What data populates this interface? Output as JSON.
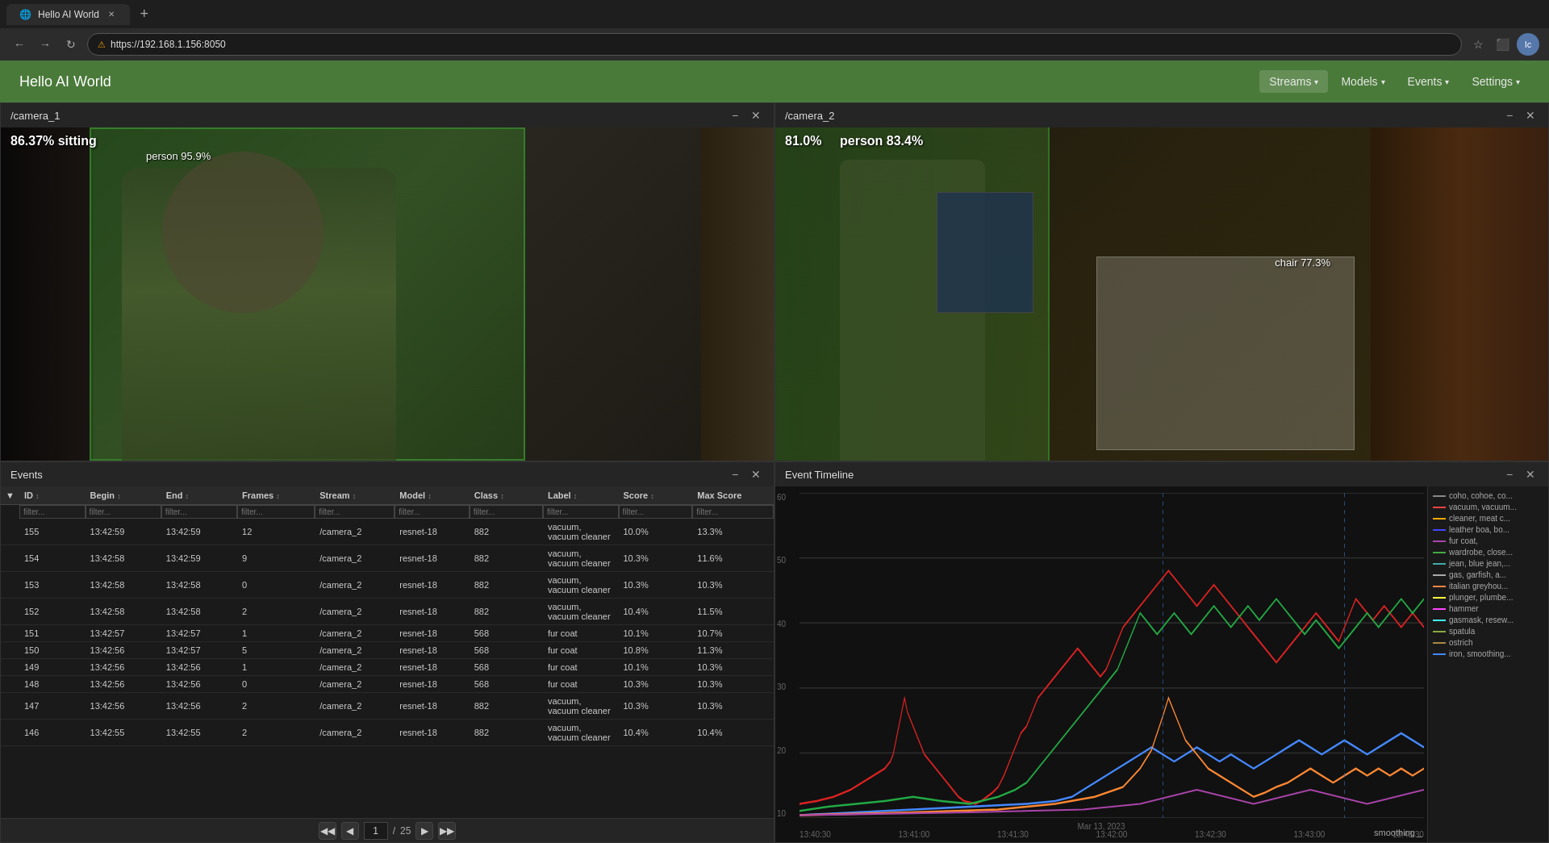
{
  "browser": {
    "tab_title": "Hello AI World",
    "address": "https://192.168.1.156:8050",
    "lock_icon": "⚠",
    "new_tab_icon": "+"
  },
  "app": {
    "title": "Hello AI World",
    "nav": [
      {
        "label": "Streams",
        "has_dropdown": true
      },
      {
        "label": "Models",
        "has_dropdown": true
      },
      {
        "label": "Events",
        "has_dropdown": true
      },
      {
        "label": "Settings",
        "has_dropdown": true
      }
    ]
  },
  "camera1": {
    "title": "/camera_1",
    "label_text": "86.37% sitting",
    "detection1_label": "person 95.9%"
  },
  "camera2": {
    "title": "/camera_2",
    "label_text1": "81.0%",
    "label_text2": "person 83.4%",
    "detection_chair": "chair 77.3%"
  },
  "events": {
    "panel_title": "Events",
    "columns": [
      {
        "label": "ID",
        "sort": "↕"
      },
      {
        "label": "Begin",
        "sort": "↕"
      },
      {
        "label": "End",
        "sort": "↕"
      },
      {
        "label": "Frames",
        "sort": "↕"
      },
      {
        "label": "Stream",
        "sort": "↕"
      },
      {
        "label": "Model",
        "sort": "↕"
      },
      {
        "label": "Class",
        "sort": "↕"
      },
      {
        "label": "Label",
        "sort": "↕"
      },
      {
        "label": "Score",
        "sort": "↕"
      },
      {
        "label": "Max Score",
        "sort": ""
      }
    ],
    "filters": [
      "filter...",
      "filter...",
      "filter...",
      "filter...",
      "filter...",
      "filter...",
      "filter...",
      "filter...",
      "filter...",
      "filter..."
    ],
    "rows": [
      {
        "id": "155",
        "begin": "13:42:59",
        "end": "13:42:59",
        "frames": "12",
        "stream": "/camera_2",
        "model": "resnet-18",
        "class": "882",
        "label": "vacuum, vacuum cleaner",
        "score": "10.0%",
        "max_score": "13.3%"
      },
      {
        "id": "154",
        "begin": "13:42:58",
        "end": "13:42:59",
        "frames": "9",
        "stream": "/camera_2",
        "model": "resnet-18",
        "class": "882",
        "label": "vacuum, vacuum cleaner",
        "score": "10.3%",
        "max_score": "11.6%"
      },
      {
        "id": "153",
        "begin": "13:42:58",
        "end": "13:42:58",
        "frames": "0",
        "stream": "/camera_2",
        "model": "resnet-18",
        "class": "882",
        "label": "vacuum, vacuum cleaner",
        "score": "10.3%",
        "max_score": "10.3%"
      },
      {
        "id": "152",
        "begin": "13:42:58",
        "end": "13:42:58",
        "frames": "2",
        "stream": "/camera_2",
        "model": "resnet-18",
        "class": "882",
        "label": "vacuum, vacuum cleaner",
        "score": "10.4%",
        "max_score": "11.5%"
      },
      {
        "id": "151",
        "begin": "13:42:57",
        "end": "13:42:57",
        "frames": "1",
        "stream": "/camera_2",
        "model": "resnet-18",
        "class": "568",
        "label": "fur coat",
        "score": "10.1%",
        "max_score": "10.7%"
      },
      {
        "id": "150",
        "begin": "13:42:56",
        "end": "13:42:57",
        "frames": "5",
        "stream": "/camera_2",
        "model": "resnet-18",
        "class": "568",
        "label": "fur coat",
        "score": "10.8%",
        "max_score": "11.3%"
      },
      {
        "id": "149",
        "begin": "13:42:56",
        "end": "13:42:56",
        "frames": "1",
        "stream": "/camera_2",
        "model": "resnet-18",
        "class": "568",
        "label": "fur coat",
        "score": "10.1%",
        "max_score": "10.3%"
      },
      {
        "id": "148",
        "begin": "13:42:56",
        "end": "13:42:56",
        "frames": "0",
        "stream": "/camera_2",
        "model": "resnet-18",
        "class": "568",
        "label": "fur coat",
        "score": "10.3%",
        "max_score": "10.3%"
      },
      {
        "id": "147",
        "begin": "13:42:56",
        "end": "13:42:56",
        "frames": "2",
        "stream": "/camera_2",
        "model": "resnet-18",
        "class": "882",
        "label": "vacuum, vacuum cleaner",
        "score": "10.3%",
        "max_score": "10.3%"
      },
      {
        "id": "146",
        "begin": "13:42:55",
        "end": "13:42:55",
        "frames": "2",
        "stream": "/camera_2",
        "model": "resnet-18",
        "class": "882",
        "label": "vacuum, vacuum cleaner",
        "score": "10.4%",
        "max_score": "10.4%"
      }
    ],
    "pagination": {
      "current_page": "1",
      "total_pages": "25",
      "prev_icon": "◀",
      "next_icon": "▶",
      "first_icon": "◀◀",
      "last_icon": "▶▶"
    }
  },
  "timeline": {
    "panel_title": "Event Timeline",
    "y_axis": [
      "60",
      "50",
      "40",
      "30",
      "20",
      "10"
    ],
    "x_axis": [
      "13:43:30",
      "13:41:00",
      "13:41:30",
      "13:42:00",
      "13:42:30",
      "13:43:00",
      "13:43:30"
    ],
    "date_label": "Mar 13, 2023",
    "smoothing_label": "smoothing _",
    "legend": [
      {
        "label": "coho, cohoe, co...",
        "color": "#888888"
      },
      {
        "label": "vacuum, vacuum...",
        "color": "#ff4444"
      },
      {
        "label": "cleaner, meat c...",
        "color": "#ffaa00"
      },
      {
        "label": "leather boa, bo...",
        "color": "#4444ff"
      },
      {
        "label": "fur coat,",
        "color": "#aa44aa"
      },
      {
        "label": "wardrobe, close...",
        "color": "#44aa44"
      },
      {
        "label": "jean, blue jean,...",
        "color": "#44aaaa"
      },
      {
        "label": "gas, garfish, a...",
        "color": "#aaaaaa"
      },
      {
        "label": "italian greyhou...",
        "color": "#ff8844"
      },
      {
        "label": "plunger, plumbe...",
        "color": "#ffff44"
      },
      {
        "label": "hammer",
        "color": "#ff44ff"
      },
      {
        "label": "gasmask, resew...",
        "color": "#44ffff"
      },
      {
        "label": "spatula",
        "color": "#88aa44"
      },
      {
        "label": "ostrich",
        "color": "#aa8844"
      },
      {
        "label": "iron, smoothing...",
        "color": "#4488ff"
      }
    ]
  }
}
